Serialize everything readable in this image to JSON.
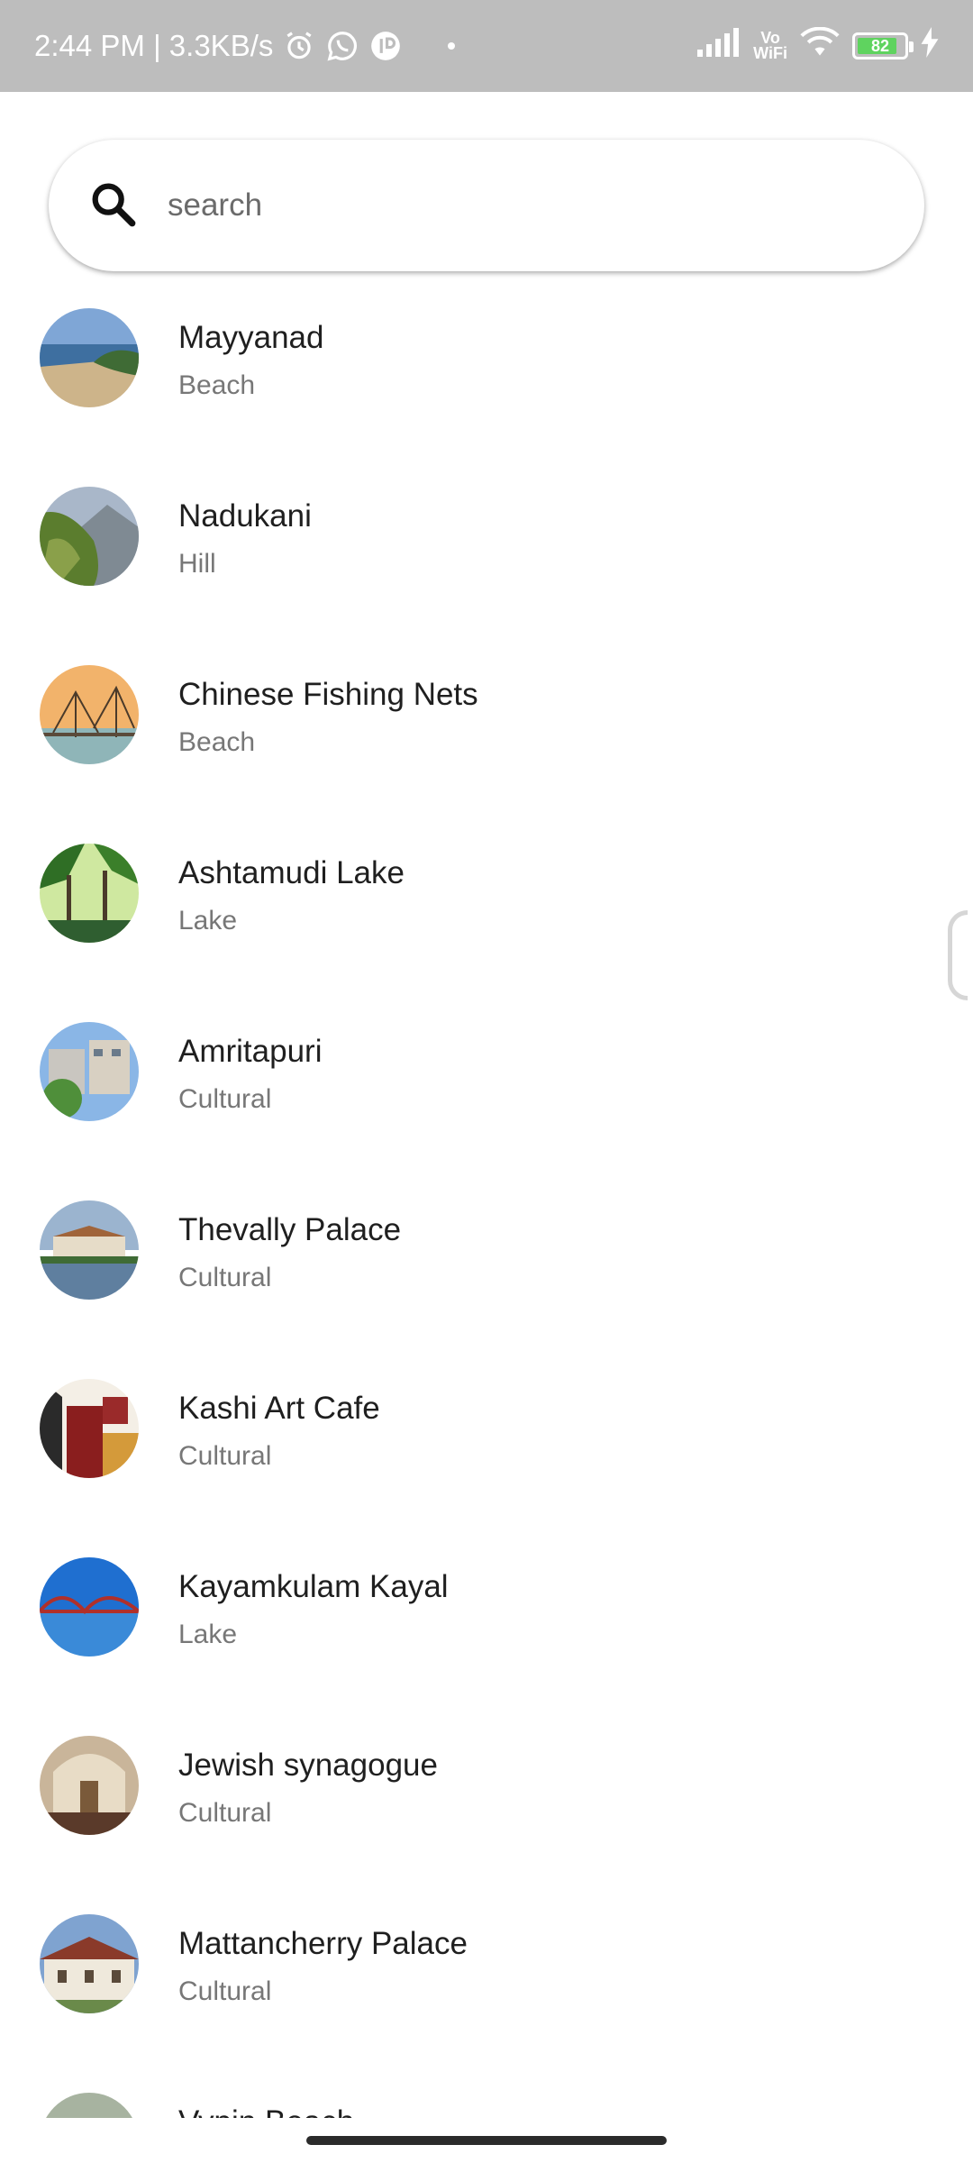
{
  "status_bar": {
    "time_speed": "2:44 PM | 3.3KB/s",
    "vowifi_top": "Vo",
    "vowifi_bottom": "WiFi",
    "battery": "82",
    "battery_level_percent": 82
  },
  "search": {
    "placeholder": "search",
    "value": ""
  },
  "places": [
    {
      "name": "Mayyanad",
      "category": "Beach"
    },
    {
      "name": "Nadukani",
      "category": "Hill"
    },
    {
      "name": "Chinese Fishing Nets",
      "category": "Beach"
    },
    {
      "name": "Ashtamudi Lake",
      "category": "Lake"
    },
    {
      "name": "Amritapuri",
      "category": "Cultural"
    },
    {
      "name": "Thevally Palace",
      "category": "Cultural"
    },
    {
      "name": "Kashi Art Cafe",
      "category": "Cultural"
    },
    {
      "name": "Kayamkulam Kayal",
      "category": "Lake"
    },
    {
      "name": "Jewish synagogue",
      "category": "Cultural"
    },
    {
      "name": "Mattancherry Palace",
      "category": "Cultural"
    },
    {
      "name": "Vypin Beach",
      "category": ""
    }
  ],
  "colors": {
    "status_bar_bg": "#bdbdbd",
    "title_text": "#1f1f1f",
    "subtitle_text": "#777777",
    "battery_fill": "#5fd35f"
  },
  "icons": {
    "search": "search-icon",
    "alarm": "alarm-icon",
    "whatsapp": "whatsapp-icon",
    "app": "app-notification-icon",
    "signal": "signal-icon",
    "wifi": "wifi-icon",
    "battery": "battery-icon",
    "charging": "charging-icon"
  }
}
